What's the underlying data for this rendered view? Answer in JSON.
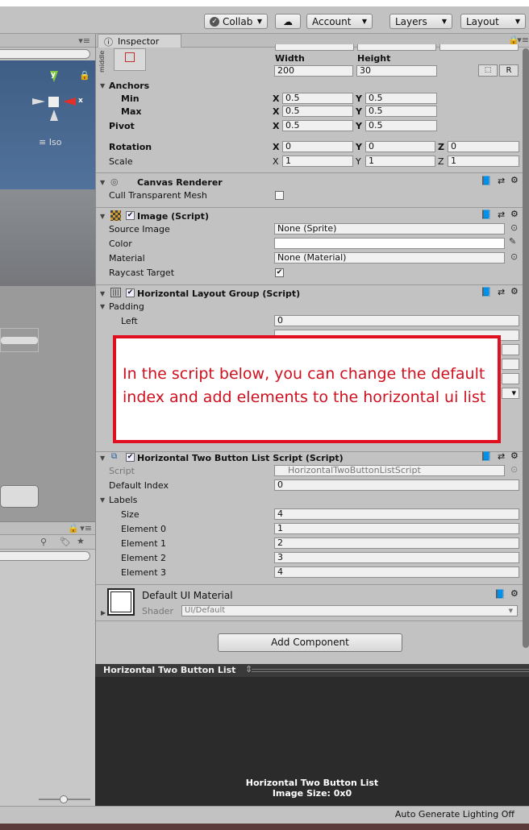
{
  "toolbar": {
    "collab": "Collab",
    "account": "Account",
    "layers": "Layers",
    "layout": "Layout"
  },
  "scene": {
    "gizmo_y": "y",
    "gizmo_x": "x",
    "iso": "Iso"
  },
  "inspector": {
    "tab": "Inspector",
    "rect": {
      "width_label": "Width",
      "height_label": "Height",
      "width": "200",
      "height": "30",
      "r_button": "R",
      "anchors": "Anchors",
      "min": "Min",
      "max": "Max",
      "pivot": "Pivot",
      "min_x": "0.5",
      "min_y": "0.5",
      "max_x": "0.5",
      "max_y": "0.5",
      "pivot_x": "0.5",
      "pivot_y": "0.5",
      "rotation": "Rotation",
      "scale": "Scale",
      "rot_x": "0",
      "rot_y": "0",
      "rot_z": "0",
      "scale_x": "1",
      "scale_y": "1",
      "scale_z": "1",
      "x": "X",
      "y": "Y",
      "z": "Z",
      "middle": "middle"
    },
    "canvas_renderer": {
      "title": "Canvas Renderer",
      "cull": "Cull Transparent Mesh"
    },
    "image": {
      "title": "Image (Script)",
      "source_label": "Source Image",
      "source_value": "None (Sprite)",
      "color_label": "Color",
      "material_label": "Material",
      "material_value": "None (Material)",
      "raycast_label": "Raycast Target"
    },
    "hlg": {
      "title": "Horizontal Layout Group (Script)",
      "padding": "Padding",
      "left": "Left",
      "left_value": "0"
    },
    "htbl": {
      "title": "Horizontal Two Button List Script (Script)",
      "script_label": "Script",
      "script_value": "HorizontalTwoButtonListScript",
      "default_index_label": "Default Index",
      "default_index_value": "0",
      "labels": "Labels",
      "size_label": "Size",
      "size_value": "4",
      "elements": [
        {
          "label": "Element 0",
          "value": "1"
        },
        {
          "label": "Element 1",
          "value": "2"
        },
        {
          "label": "Element 2",
          "value": "3"
        },
        {
          "label": "Element 3",
          "value": "4"
        }
      ]
    },
    "material": {
      "title": "Default UI Material",
      "shader_label": "Shader",
      "shader_value": "UI/Default"
    },
    "add_component": "Add Component"
  },
  "annotation": "In the script below, you can change the default index and add elements to the horizontal ui list",
  "preview": {
    "title": "Horizontal Two Button List",
    "name": "Horizontal Two Button List",
    "size": "Image Size: 0x0"
  },
  "status": {
    "lighting": "Auto Generate Lighting Off"
  }
}
